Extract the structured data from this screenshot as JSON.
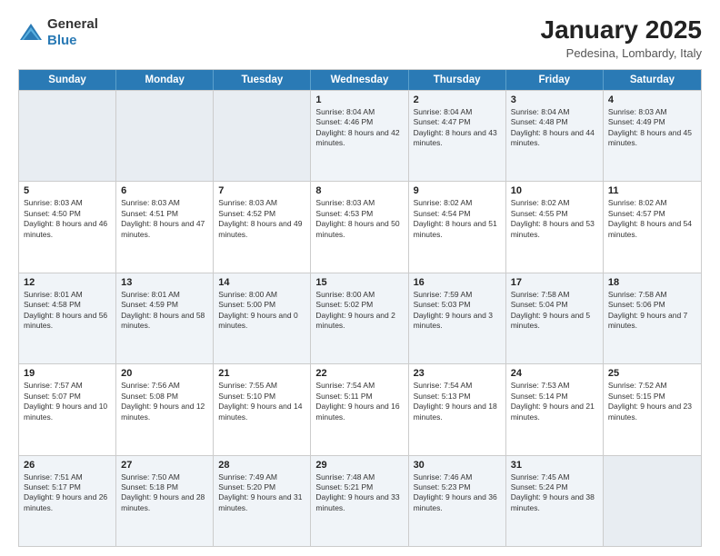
{
  "header": {
    "logo_general": "General",
    "logo_blue": "Blue",
    "title": "January 2025",
    "subtitle": "Pedesina, Lombardy, Italy"
  },
  "weekdays": [
    "Sunday",
    "Monday",
    "Tuesday",
    "Wednesday",
    "Thursday",
    "Friday",
    "Saturday"
  ],
  "rows": [
    [
      {
        "day": "",
        "info": ""
      },
      {
        "day": "",
        "info": ""
      },
      {
        "day": "",
        "info": ""
      },
      {
        "day": "1",
        "info": "Sunrise: 8:04 AM\nSunset: 4:46 PM\nDaylight: 8 hours and 42 minutes."
      },
      {
        "day": "2",
        "info": "Sunrise: 8:04 AM\nSunset: 4:47 PM\nDaylight: 8 hours and 43 minutes."
      },
      {
        "day": "3",
        "info": "Sunrise: 8:04 AM\nSunset: 4:48 PM\nDaylight: 8 hours and 44 minutes."
      },
      {
        "day": "4",
        "info": "Sunrise: 8:03 AM\nSunset: 4:49 PM\nDaylight: 8 hours and 45 minutes."
      }
    ],
    [
      {
        "day": "5",
        "info": "Sunrise: 8:03 AM\nSunset: 4:50 PM\nDaylight: 8 hours and 46 minutes."
      },
      {
        "day": "6",
        "info": "Sunrise: 8:03 AM\nSunset: 4:51 PM\nDaylight: 8 hours and 47 minutes."
      },
      {
        "day": "7",
        "info": "Sunrise: 8:03 AM\nSunset: 4:52 PM\nDaylight: 8 hours and 49 minutes."
      },
      {
        "day": "8",
        "info": "Sunrise: 8:03 AM\nSunset: 4:53 PM\nDaylight: 8 hours and 50 minutes."
      },
      {
        "day": "9",
        "info": "Sunrise: 8:02 AM\nSunset: 4:54 PM\nDaylight: 8 hours and 51 minutes."
      },
      {
        "day": "10",
        "info": "Sunrise: 8:02 AM\nSunset: 4:55 PM\nDaylight: 8 hours and 53 minutes."
      },
      {
        "day": "11",
        "info": "Sunrise: 8:02 AM\nSunset: 4:57 PM\nDaylight: 8 hours and 54 minutes."
      }
    ],
    [
      {
        "day": "12",
        "info": "Sunrise: 8:01 AM\nSunset: 4:58 PM\nDaylight: 8 hours and 56 minutes."
      },
      {
        "day": "13",
        "info": "Sunrise: 8:01 AM\nSunset: 4:59 PM\nDaylight: 8 hours and 58 minutes."
      },
      {
        "day": "14",
        "info": "Sunrise: 8:00 AM\nSunset: 5:00 PM\nDaylight: 9 hours and 0 minutes."
      },
      {
        "day": "15",
        "info": "Sunrise: 8:00 AM\nSunset: 5:02 PM\nDaylight: 9 hours and 2 minutes."
      },
      {
        "day": "16",
        "info": "Sunrise: 7:59 AM\nSunset: 5:03 PM\nDaylight: 9 hours and 3 minutes."
      },
      {
        "day": "17",
        "info": "Sunrise: 7:58 AM\nSunset: 5:04 PM\nDaylight: 9 hours and 5 minutes."
      },
      {
        "day": "18",
        "info": "Sunrise: 7:58 AM\nSunset: 5:06 PM\nDaylight: 9 hours and 7 minutes."
      }
    ],
    [
      {
        "day": "19",
        "info": "Sunrise: 7:57 AM\nSunset: 5:07 PM\nDaylight: 9 hours and 10 minutes."
      },
      {
        "day": "20",
        "info": "Sunrise: 7:56 AM\nSunset: 5:08 PM\nDaylight: 9 hours and 12 minutes."
      },
      {
        "day": "21",
        "info": "Sunrise: 7:55 AM\nSunset: 5:10 PM\nDaylight: 9 hours and 14 minutes."
      },
      {
        "day": "22",
        "info": "Sunrise: 7:54 AM\nSunset: 5:11 PM\nDaylight: 9 hours and 16 minutes."
      },
      {
        "day": "23",
        "info": "Sunrise: 7:54 AM\nSunset: 5:13 PM\nDaylight: 9 hours and 18 minutes."
      },
      {
        "day": "24",
        "info": "Sunrise: 7:53 AM\nSunset: 5:14 PM\nDaylight: 9 hours and 21 minutes."
      },
      {
        "day": "25",
        "info": "Sunrise: 7:52 AM\nSunset: 5:15 PM\nDaylight: 9 hours and 23 minutes."
      }
    ],
    [
      {
        "day": "26",
        "info": "Sunrise: 7:51 AM\nSunset: 5:17 PM\nDaylight: 9 hours and 26 minutes."
      },
      {
        "day": "27",
        "info": "Sunrise: 7:50 AM\nSunset: 5:18 PM\nDaylight: 9 hours and 28 minutes."
      },
      {
        "day": "28",
        "info": "Sunrise: 7:49 AM\nSunset: 5:20 PM\nDaylight: 9 hours and 31 minutes."
      },
      {
        "day": "29",
        "info": "Sunrise: 7:48 AM\nSunset: 5:21 PM\nDaylight: 9 hours and 33 minutes."
      },
      {
        "day": "30",
        "info": "Sunrise: 7:46 AM\nSunset: 5:23 PM\nDaylight: 9 hours and 36 minutes."
      },
      {
        "day": "31",
        "info": "Sunrise: 7:45 AM\nSunset: 5:24 PM\nDaylight: 9 hours and 38 minutes."
      },
      {
        "day": "",
        "info": ""
      }
    ]
  ]
}
